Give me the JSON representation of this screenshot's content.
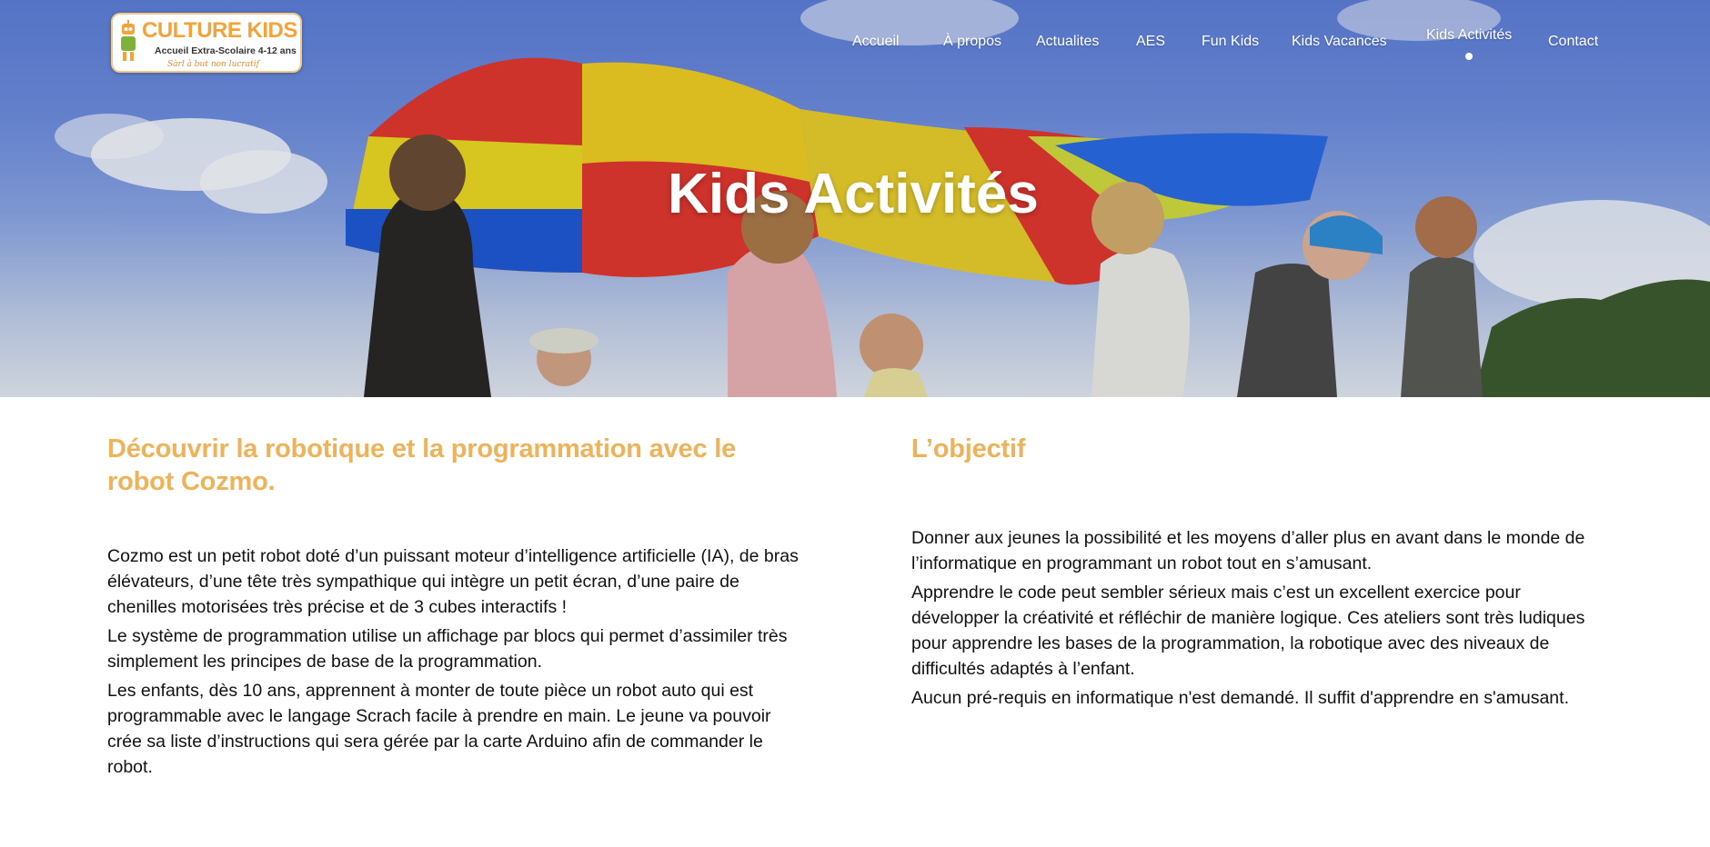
{
  "logo": {
    "brand_part1": "CULTURE",
    "brand_part2": "KIDS",
    "subtitle": "Accueil Extra-Scolaire 4-12 ans",
    "tagline": "Sàrl à but non lucratif"
  },
  "nav": {
    "items": [
      {
        "label": "Accueil"
      },
      {
        "label": "À propos"
      },
      {
        "label": "Actualites"
      },
      {
        "label": "AES"
      },
      {
        "label": "Fun Kids"
      },
      {
        "label": "Kids Vacances"
      },
      {
        "label": "Kids Activités",
        "active": true
      },
      {
        "label": "Contact"
      }
    ]
  },
  "hero": {
    "title": "Kids Activités"
  },
  "left": {
    "heading": "Découvrir la robotique et la programmation avec le robot Cozmo.",
    "paragraphs": [
      "Cozmo est un petit robot doté d’un puissant moteur d’intelligence artificielle (IA), de bras élévateurs, d’une tête très sympathique qui intègre un petit écran, d’une paire de chenilles motorisées très précise et de 3 cubes interactifs !",
      "Le système de programmation utilise un affichage par blocs qui permet d’assimiler très simplement les principes de base de la programmation.",
      "Les enfants, dès 10 ans, apprennent à monter de toute pièce un robot auto qui est programmable avec le langage Scrach facile à prendre en main. Le jeune va pouvoir crée sa liste d’instructions qui sera gérée par la carte Arduino afin de commander le robot."
    ]
  },
  "right": {
    "heading": "L’objectif",
    "paragraphs": [
      "Donner aux jeunes la possibilité et les moyens d’aller plus en avant dans le monde de l’informatique en programmant un robot tout en s’amusant.",
      "Apprendre le code peut sembler sérieux mais c’est un excellent exercice pour développer la créativité et réfléchir de manière logique. Ces ateliers sont très ludiques pour apprendre les bases de la programmation, la robotique avec des niveaux de difficultés adaptés à l’enfant.",
      "Aucun pré-requis en informatique n'est demandé. Il suffit d'apprendre en s'amusant."
    ]
  },
  "colors": {
    "heading": "#eeb35a",
    "logo_green": "#7db33a",
    "logo_orange": "#f2a33a"
  }
}
